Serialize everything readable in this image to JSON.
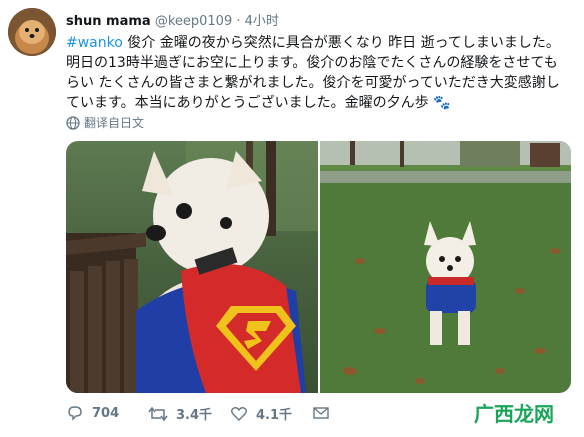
{
  "tweet": {
    "display_name": "shun mama",
    "handle": "@keep0109",
    "separator": "·",
    "time": "4小时",
    "hashtag": "#wanko",
    "body_after_hashtag": " 俊介 金曜の夜から突然に具合が悪くなり 昨日 逝ってしまいました。明日の13時半過ぎにお空に上ります。俊介のお陰でたくさんの経験をさせてもらい たくさんの皆さまと繋がれました。俊介を可愛がっていただき大変感謝しています。本当にありがとうございました。金曜の夕ん歩",
    "paw_emoji": "🐾",
    "translate_label": "翻译自日文"
  },
  "actions": {
    "reply_count": "704",
    "retweet_count": "3.4千",
    "like_count": "4.1千"
  },
  "watermark": {
    "text": "广西龙网"
  }
}
